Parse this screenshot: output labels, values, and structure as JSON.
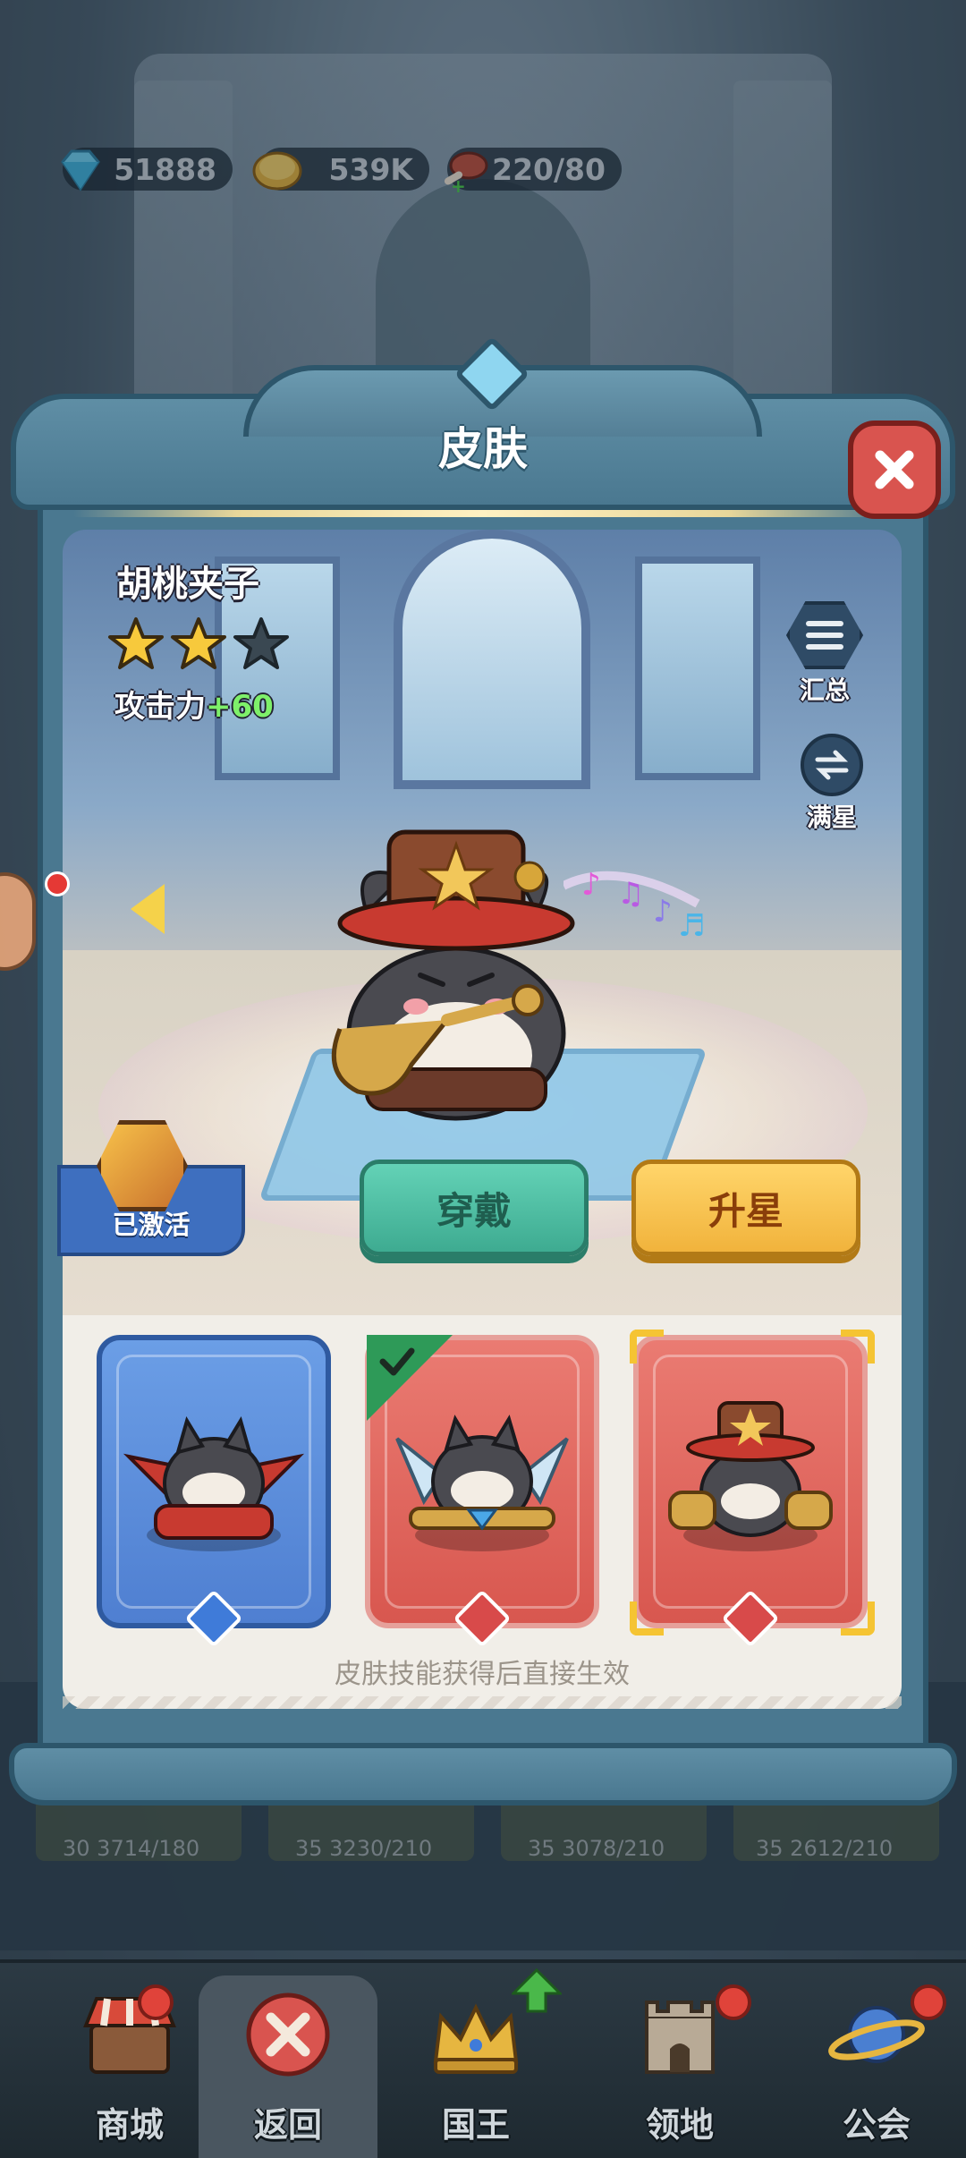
{
  "resources": {
    "gems": "51888",
    "gold": "539K",
    "stamina": "220/80"
  },
  "modal": {
    "title": "皮肤"
  },
  "skin": {
    "name": "胡桃夹子",
    "stars_filled": 2,
    "stars_total": 3,
    "attack_label": "攻击力",
    "attack_bonus": "+60"
  },
  "side_buttons": {
    "summary": "汇总",
    "max_star": "满星"
  },
  "actions": {
    "activated": "已激活",
    "wear": "穿戴",
    "upgrade_star": "升星"
  },
  "skins_panel": {
    "note": "皮肤技能获得后直接生效",
    "cards": [
      {
        "frame": "blue",
        "selected": false,
        "equipped": false
      },
      {
        "frame": "red",
        "selected": false,
        "equipped": true
      },
      {
        "frame": "red",
        "selected": true,
        "equipped": false
      }
    ]
  },
  "background_cards": [
    "30 3714/180",
    "35 3230/210",
    "35 3078/210",
    "35 2612/210"
  ],
  "nav": {
    "items": [
      {
        "label": "商城",
        "icon": "shop-icon",
        "badge": true
      },
      {
        "label": "返回",
        "icon": "close-icon",
        "badge": false,
        "active": true
      },
      {
        "label": "国王",
        "icon": "crown-icon",
        "badge": false
      },
      {
        "label": "领地",
        "icon": "castle-icon",
        "badge": true
      },
      {
        "label": "公会",
        "icon": "planet-icon",
        "badge": true
      }
    ]
  },
  "colors": {
    "frame": "#4a7890",
    "wear_button": "#4cc2a4",
    "star_button": "#f5c04a",
    "attack_bonus": "#7ef06a",
    "close_button": "#d9544f"
  }
}
